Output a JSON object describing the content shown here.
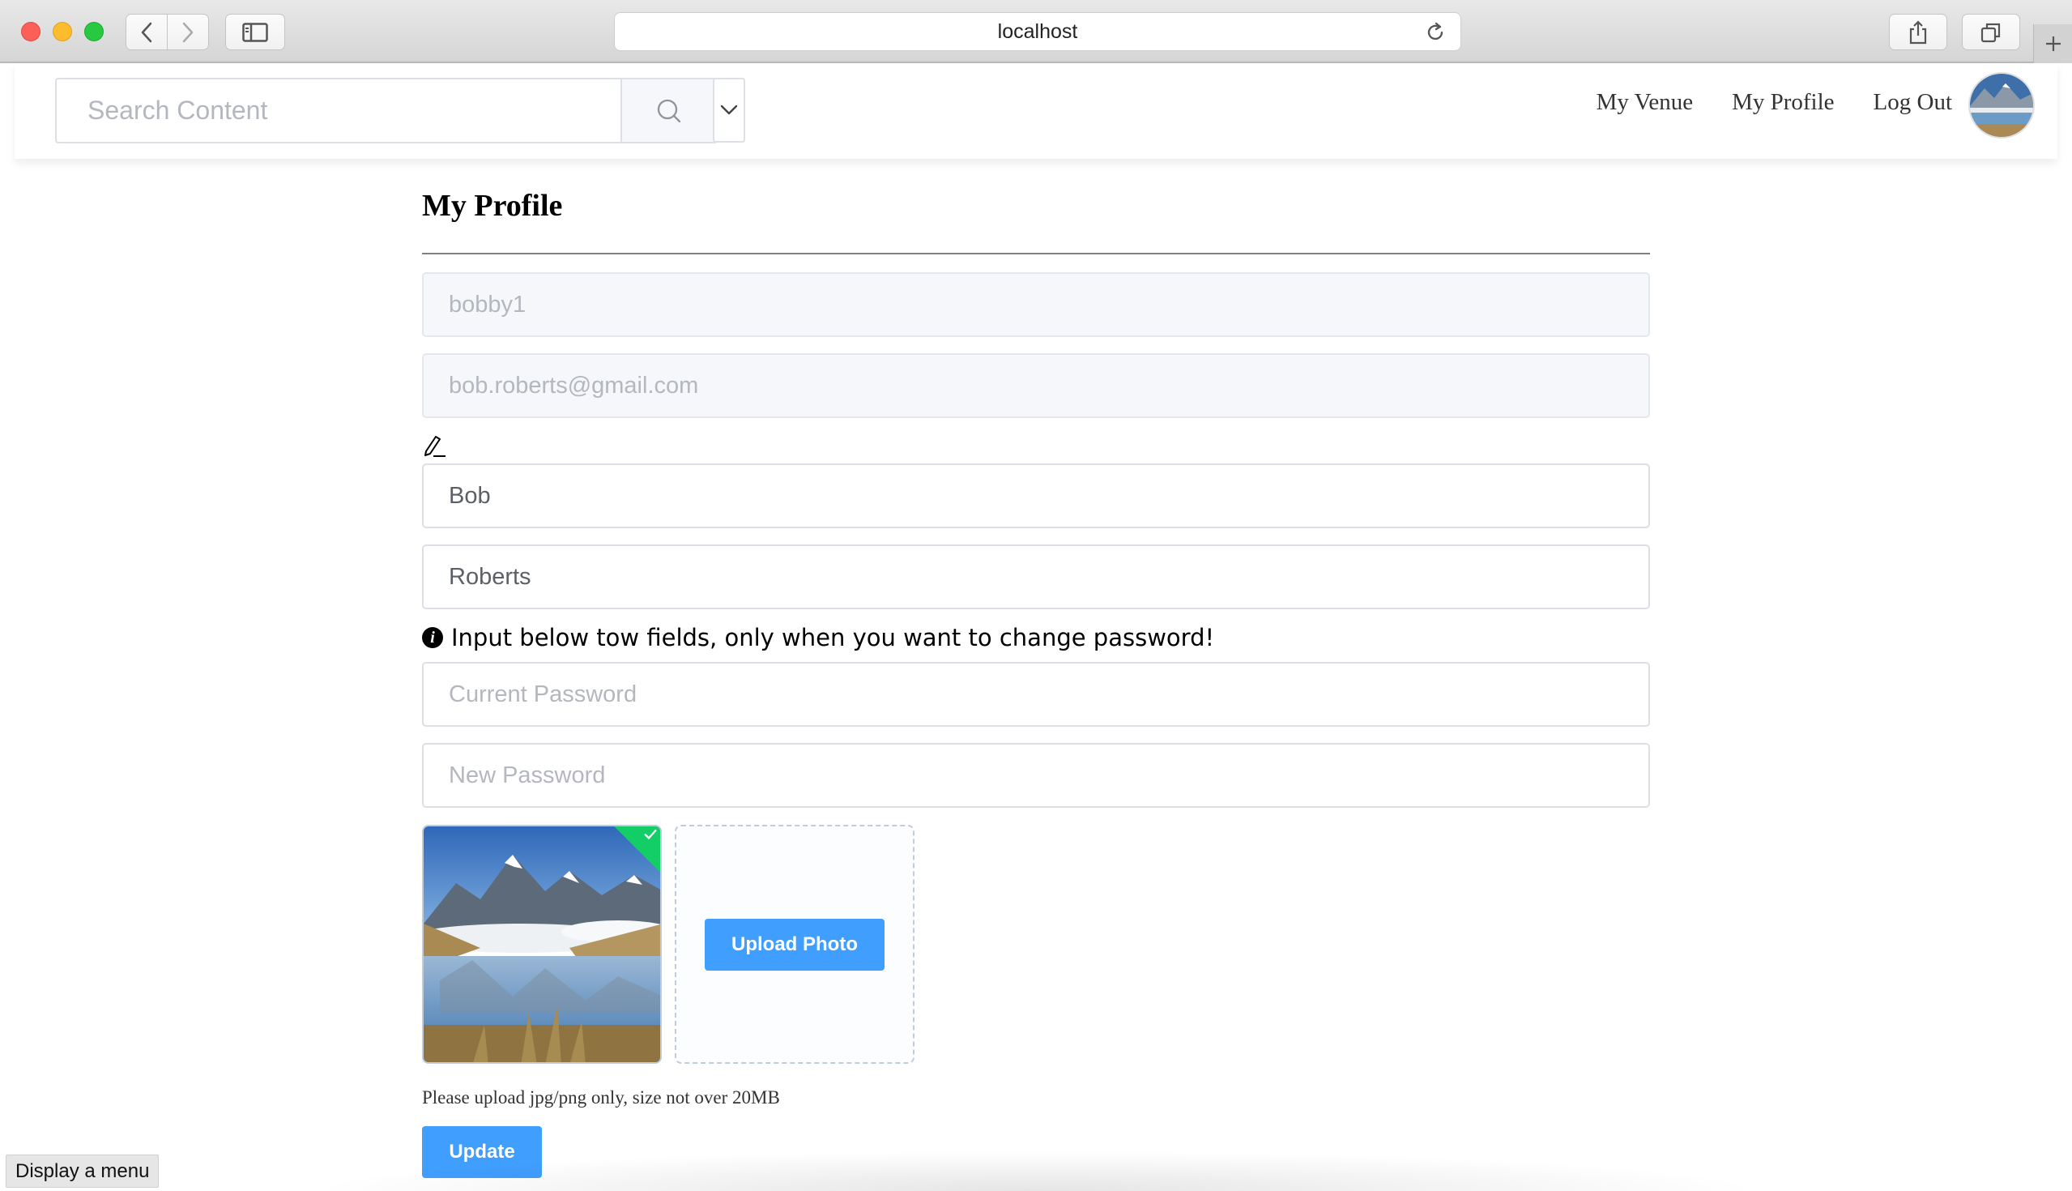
{
  "browser": {
    "url": "localhost",
    "icons": [
      "back-icon",
      "forward-icon",
      "sidebar-icon",
      "reload-icon",
      "share-icon",
      "tabs-icon",
      "plus-icon"
    ]
  },
  "header": {
    "search": {
      "placeholder": "Search Content",
      "value": ""
    },
    "nav": [
      {
        "label": "My Venue"
      },
      {
        "label": "My Profile"
      },
      {
        "label": "Log Out"
      }
    ]
  },
  "profile": {
    "title": "My Profile",
    "username": "bobby1",
    "email": "bob.roberts@gmail.com",
    "first_name": "Bob",
    "last_name": "Roberts",
    "password_notice": "Input below tow fields, only when you want to change password!",
    "current_password_placeholder": "Current Password",
    "new_password_placeholder": "New Password",
    "upload_label": "Upload Photo",
    "upload_hint": "Please upload jpg/png only, size not over 20MB",
    "update_label": "Update"
  },
  "colors": {
    "primary": "#409eff",
    "success": "#13ce66",
    "border": "#dcdfe6",
    "disabled_bg": "#f5f7fa"
  },
  "tooltip": "Display a menu"
}
